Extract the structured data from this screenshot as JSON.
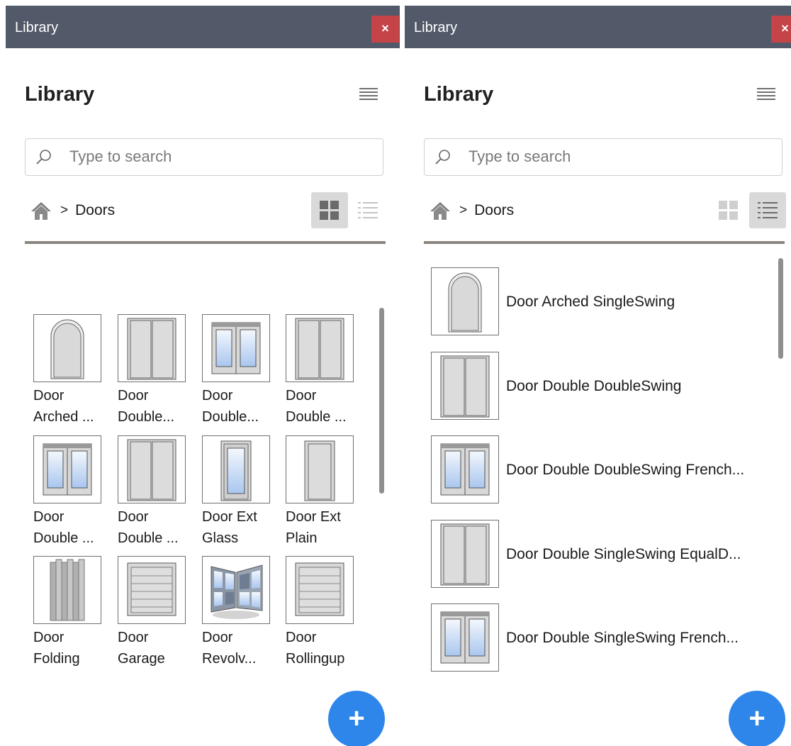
{
  "icons": {
    "close": "close-icon",
    "menu": "hamburger-menu-icon",
    "search": "search-icon",
    "home": "home-icon",
    "grid_view": "grid-view-icon",
    "list_view": "list-view-icon",
    "add": "plus-icon"
  },
  "colors": {
    "titlebar": "#525a69",
    "close": "#c54448",
    "accent": "#2f86ea",
    "rule": "#8c8580"
  },
  "grid_panel": {
    "window_title": "Library",
    "close_label": "×",
    "heading": "Library",
    "search_placeholder": "Type to search",
    "breadcrumb_sep": ">",
    "breadcrumb_folder": "Doors",
    "active_view": "grid",
    "add_label": "+",
    "items": [
      {
        "line1": "Door",
        "line2": "Arched ...",
        "icon": "door-arched-icon"
      },
      {
        "line1": "Door",
        "line2": "Double...",
        "icon": "door-double-icon"
      },
      {
        "line1": "Door",
        "line2": "Double...",
        "icon": "door-double-french-icon"
      },
      {
        "line1": "Door",
        "line2": "Double ...",
        "icon": "door-double-icon"
      },
      {
        "line1": "Door",
        "line2": "Double ...",
        "icon": "door-double-french-icon"
      },
      {
        "line1": "Door",
        "line2": "Double ...",
        "icon": "door-double-icon"
      },
      {
        "line1": "Door Ext",
        "line2": "Glass",
        "icon": "door-ext-glass-icon"
      },
      {
        "line1": "Door Ext",
        "line2": "Plain",
        "icon": "door-ext-plain-icon"
      },
      {
        "line1": "Door",
        "line2": "Folding",
        "icon": "door-folding-icon"
      },
      {
        "line1": "Door",
        "line2": "Garage",
        "icon": "door-garage-icon"
      },
      {
        "line1": "Door",
        "line2": "Revolv...",
        "icon": "door-revolving-icon"
      },
      {
        "line1": "Door",
        "line2": "Rollingup",
        "icon": "door-rollingup-icon"
      }
    ]
  },
  "list_panel": {
    "window_title": "Library",
    "close_label": "×",
    "heading": "Library",
    "search_placeholder": "Type to search",
    "breadcrumb_sep": ">",
    "breadcrumb_folder": "Doors",
    "active_view": "list",
    "add_label": "+",
    "items": [
      {
        "label": "Door Arched SingleSwing",
        "icon": "door-arched-icon"
      },
      {
        "label": "Door Double DoubleSwing",
        "icon": "door-double-icon"
      },
      {
        "label": "Door Double DoubleSwing French...",
        "icon": "door-double-french-icon"
      },
      {
        "label": "Door Double SingleSwing EqualD...",
        "icon": "door-double-icon"
      },
      {
        "label": "Door Double SingleSwing French...",
        "icon": "door-double-french-icon"
      }
    ]
  }
}
